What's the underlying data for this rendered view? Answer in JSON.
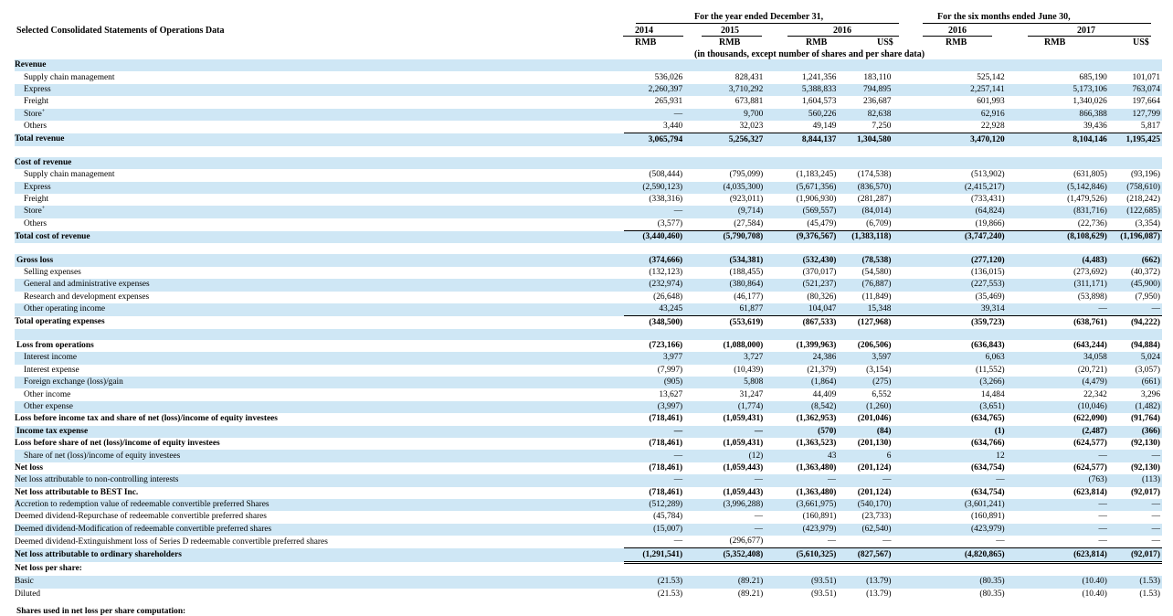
{
  "document": {
    "section_title": "Selected Consolidated Statements of Operations Data",
    "period_headers": {
      "year": "For the year ended December 31,",
      "six_months": "For the six months ended June 30,"
    },
    "year_headers": {
      "y2014": "2014",
      "y2015": "2015",
      "y2016": "2016",
      "h2016": "2016",
      "h2017": "2017"
    },
    "currency_headers": [
      "RMB",
      "RMB",
      "RMB",
      "US$",
      "RMB",
      "RMB",
      "US$"
    ],
    "units_note": "(in thousands, except number of shares and per share data)",
    "cutoff_text": "Shares used in net loss per share computation:"
  },
  "rows": [
    {
      "label": "Revenue",
      "style": "head",
      "values": [
        "",
        "",
        "",
        "",
        "",
        "",
        ""
      ]
    },
    {
      "label": "Supply chain management",
      "style": "item",
      "values": [
        "536,026",
        "828,431",
        "1,241,356",
        "183,110",
        "525,142",
        "685,190",
        "101,071"
      ]
    },
    {
      "label": "Express",
      "style": "item",
      "values": [
        "2,260,397",
        "3,710,292",
        "5,388,833",
        "794,895",
        "2,257,141",
        "5,173,106",
        "763,074"
      ]
    },
    {
      "label": "Freight",
      "style": "item",
      "values": [
        "265,931",
        "673,881",
        "1,604,573",
        "236,687",
        "601,993",
        "1,340,026",
        "197,664"
      ]
    },
    {
      "label": "Store",
      "sup": "+",
      "style": "item",
      "values": [
        "—",
        "9,700",
        "560,226",
        "82,638",
        "62,916",
        "866,388",
        "127,799"
      ]
    },
    {
      "label": "Others",
      "style": "item",
      "values": [
        "3,440",
        "32,023",
        "49,149",
        "7,250",
        "22,928",
        "39,436",
        "5,817"
      ]
    },
    {
      "label": "Total revenue",
      "style": "total",
      "values": [
        "3,065,794",
        "5,256,327",
        "8,844,137",
        "1,304,580",
        "3,470,120",
        "8,104,146",
        "1,195,425"
      ]
    },
    {
      "label": "",
      "style": "blank",
      "values": [
        "",
        "",
        "",
        "",
        "",
        "",
        ""
      ]
    },
    {
      "label": "Cost of revenue",
      "style": "head",
      "values": [
        "",
        "",
        "",
        "",
        "",
        "",
        ""
      ]
    },
    {
      "label": "Supply chain management",
      "style": "item",
      "values": [
        "(508,444)",
        "(795,099)",
        "(1,183,245)",
        "(174,538)",
        "(513,902)",
        "(631,805)",
        "(93,196)"
      ]
    },
    {
      "label": "Express",
      "style": "item",
      "values": [
        "(2,590,123)",
        "(4,035,300)",
        "(5,671,356)",
        "(836,570)",
        "(2,415,217)",
        "(5,142,846)",
        "(758,610)"
      ]
    },
    {
      "label": "Freight",
      "style": "item",
      "values": [
        "(338,316)",
        "(923,011)",
        "(1,906,930)",
        "(281,287)",
        "(733,431)",
        "(1,479,526)",
        "(218,242)"
      ]
    },
    {
      "label": "Store",
      "sup": "+",
      "style": "item",
      "values": [
        "—",
        "(9,714)",
        "(569,557)",
        "(84,014)",
        "(64,824)",
        "(831,716)",
        "(122,685)"
      ]
    },
    {
      "label": "Others",
      "style": "item",
      "values": [
        "(3,577)",
        "(27,584)",
        "(45,479)",
        "(6,709)",
        "(19,866)",
        "(22,736)",
        "(3,354)"
      ]
    },
    {
      "label": "Total cost of revenue",
      "style": "total",
      "values": [
        "(3,440,460)",
        "(5,790,708)",
        "(9,376,567)",
        "(1,383,118)",
        "(3,747,240)",
        "(8,108,629)",
        "(1,196,087)"
      ]
    },
    {
      "label": "",
      "style": "blank",
      "values": [
        "",
        "",
        "",
        "",
        "",
        "",
        ""
      ]
    },
    {
      "label": "Gross loss",
      "style": "headnum",
      "values": [
        "(374,666)",
        "(534,381)",
        "(532,430)",
        "(78,538)",
        "(277,120)",
        "(4,483)",
        "(662)"
      ]
    },
    {
      "label": "Selling expenses",
      "style": "item",
      "values": [
        "(132,123)",
        "(188,455)",
        "(370,017)",
        "(54,580)",
        "(136,015)",
        "(273,692)",
        "(40,372)"
      ]
    },
    {
      "label": "General and administrative expenses",
      "style": "item",
      "values": [
        "(232,974)",
        "(380,864)",
        "(521,237)",
        "(76,887)",
        "(227,553)",
        "(311,171)",
        "(45,900)"
      ]
    },
    {
      "label": "Research and development expenses",
      "style": "item",
      "values": [
        "(26,648)",
        "(46,177)",
        "(80,326)",
        "(11,849)",
        "(35,469)",
        "(53,898)",
        "(7,950)"
      ]
    },
    {
      "label": "Other operating income",
      "style": "item",
      "values": [
        "43,245",
        "61,877",
        "104,047",
        "15,348",
        "39,314",
        "—",
        "—"
      ]
    },
    {
      "label": "Total operating expenses",
      "style": "total",
      "values": [
        "(348,500)",
        "(553,619)",
        "(867,533)",
        "(127,968)",
        "(359,723)",
        "(638,761)",
        "(94,222)"
      ]
    },
    {
      "label": "",
      "style": "blank",
      "values": [
        "",
        "",
        "",
        "",
        "",
        "",
        ""
      ]
    },
    {
      "label": "Loss from operations",
      "style": "headnum",
      "values": [
        "(723,166)",
        "(1,088,000)",
        "(1,399,963)",
        "(206,506)",
        "(636,843)",
        "(643,244)",
        "(94,884)"
      ]
    },
    {
      "label": "Interest income",
      "style": "item",
      "values": [
        "3,977",
        "3,727",
        "24,386",
        "3,597",
        "6,063",
        "34,058",
        "5,024"
      ]
    },
    {
      "label": "Interest expense",
      "style": "item",
      "values": [
        "(7,997)",
        "(10,439)",
        "(21,379)",
        "(3,154)",
        "(11,552)",
        "(20,721)",
        "(3,057)"
      ]
    },
    {
      "label": "Foreign exchange (loss)/gain",
      "style": "item",
      "values": [
        "(905)",
        "5,808",
        "(1,864)",
        "(275)",
        "(3,266)",
        "(4,479)",
        "(661)"
      ]
    },
    {
      "label": "Other income",
      "style": "item",
      "values": [
        "13,627",
        "31,247",
        "44,409",
        "6,552",
        "14,484",
        "22,342",
        "3,296"
      ]
    },
    {
      "label": "Other expense",
      "style": "item",
      "values": [
        "(3,997)",
        "(1,774)",
        "(8,542)",
        "(1,260)",
        "(3,651)",
        "(10,046)",
        "(1,482)"
      ]
    },
    {
      "label": "Loss before income tax and share of net (loss)/income of equity investees",
      "style": "subtotal",
      "values": [
        "(718,461)",
        "(1,059,431)",
        "(1,362,953)",
        "(201,046)",
        "(634,765)",
        "(622,090)",
        "(91,764)"
      ]
    },
    {
      "label": "Income tax expense",
      "style": "headnum",
      "values": [
        "—",
        "—",
        "(570)",
        "(84)",
        "(1)",
        "(2,487)",
        "(366)"
      ]
    },
    {
      "label": "Loss before share of net (loss)/income of equity investees",
      "style": "subtotal",
      "values": [
        "(718,461)",
        "(1,059,431)",
        "(1,363,523)",
        "(201,130)",
        "(634,766)",
        "(624,577)",
        "(92,130)"
      ]
    },
    {
      "label": "Share of net (loss)/income of equity investees",
      "style": "item",
      "values": [
        "—",
        "(12)",
        "43",
        "6",
        "12",
        "—",
        "—"
      ]
    },
    {
      "label": "Net loss",
      "style": "subtotal",
      "values": [
        "(718,461)",
        "(1,059,443)",
        "(1,363,480)",
        "(201,124)",
        "(634,754)",
        "(624,577)",
        "(92,130)"
      ]
    },
    {
      "label": "Net loss attributable to non-controlling interests",
      "style": "plain",
      "values": [
        "—",
        "—",
        "—",
        "—",
        "—",
        "(763)",
        "(113)"
      ]
    },
    {
      "label": "Net loss attributable to BEST Inc.",
      "style": "subtotal",
      "values": [
        "(718,461)",
        "(1,059,443)",
        "(1,363,480)",
        "(201,124)",
        "(634,754)",
        "(623,814)",
        "(92,017)"
      ]
    },
    {
      "label": "Accretion to redemption value of redeemable convertible preferred Shares",
      "style": "plain",
      "values": [
        "(512,289)",
        "(3,996,288)",
        "(3,661,975)",
        "(540,170)",
        "(3,601,241)",
        "—",
        "—"
      ]
    },
    {
      "label": "Deemed dividend-Repurchase of redeemable convertible preferred shares",
      "style": "plain",
      "values": [
        "(45,784)",
        "—",
        "(160,891)",
        "(23,733)",
        "(160,891)",
        "—",
        "—"
      ]
    },
    {
      "label": "Deemed dividend-Modification of redeemable convertible preferred shares",
      "style": "plain",
      "values": [
        "(15,007)",
        "—",
        "(423,979)",
        "(62,540)",
        "(423,979)",
        "—",
        "—"
      ]
    },
    {
      "label": "Deemed dividend-Extinguishment loss of Series D redeemable convertible preferred shares",
      "style": "plain",
      "values": [
        "—",
        "(296,677)",
        "—",
        "—",
        "—",
        "—",
        "—"
      ]
    },
    {
      "label": "Net loss attributable to ordinary shareholders",
      "style": "final",
      "values": [
        "(1,291,541)",
        "(5,352,408)",
        "(5,610,325)",
        "(827,567)",
        "(4,820,865)",
        "(623,814)",
        "(92,017)"
      ]
    },
    {
      "label": "Net loss per share:",
      "style": "head",
      "values": [
        "",
        "",
        "",
        "",
        "",
        "",
        ""
      ]
    },
    {
      "label": "Basic",
      "style": "plain",
      "values": [
        "(21.53)",
        "(89.21)",
        "(93.51)",
        "(13.79)",
        "(80.35)",
        "(10.40)",
        "(1.53)"
      ]
    },
    {
      "label": "Diluted",
      "style": "plain",
      "values": [
        "(21.53)",
        "(89.21)",
        "(93.51)",
        "(13.79)",
        "(80.35)",
        "(10.40)",
        "(1.53)"
      ]
    }
  ]
}
